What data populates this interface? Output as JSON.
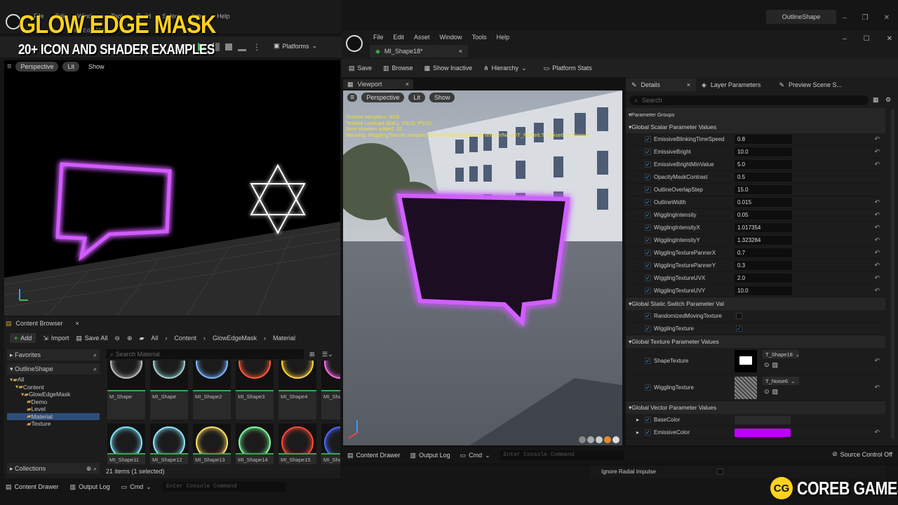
{
  "overlay": {
    "title": "GLOW EDGE MASK",
    "subtitle": "20+ ICON AND SHADER EXAMPLES",
    "brand_mark": "CG",
    "brand_name": "COREB GAMES"
  },
  "left_editor": {
    "menu": [
      "File",
      "Edit",
      "Window",
      "Tools",
      "Build",
      "Select",
      "Actor",
      "Help"
    ],
    "project_tab": "GlowEdgeMask",
    "toolbar": {
      "platforms": "Platforms"
    },
    "viewport": {
      "perspective": "Perspective",
      "lit": "Lit",
      "show": "Show"
    },
    "window_title": "OutlineShape"
  },
  "content_browser": {
    "tab": "Content Browser",
    "add": "Add",
    "import": "Import",
    "save_all": "Save All",
    "breadcrumb": [
      "All",
      "Content",
      "GlowEdgeMask",
      "Material"
    ],
    "favorites": "Favorites",
    "project": "OutlineShape",
    "tree": [
      {
        "label": "All",
        "depth": 0
      },
      {
        "label": "Content",
        "depth": 1
      },
      {
        "label": "GlowEdgeMask",
        "depth": 2
      },
      {
        "label": "Demo",
        "depth": 3
      },
      {
        "label": "Level",
        "depth": 3
      },
      {
        "label": "Material",
        "depth": 3,
        "selected": true
      },
      {
        "label": "Texture",
        "depth": 3
      }
    ],
    "collections": "Collections",
    "search_placeholder": "Search Material",
    "assets_row1": [
      "M_Shape",
      "MI_Shape",
      "MI_Shape2",
      "MI_Shape3",
      "MI_Shape4",
      "MI_Sha"
    ],
    "assets_row2": [
      "MI_Shape11",
      "MI_Shape12",
      "MI_Shape13",
      "MI_Shape14",
      "MI_Shape15",
      "MI_Sha"
    ],
    "status": "21 items (1 selected)"
  },
  "bottom_bar": {
    "content_drawer": "Content Drawer",
    "output_log": "Output Log",
    "cmd": "Cmd",
    "console_placeholder": "Enter Console Command",
    "ignore_radial": "Ignore Radial Impulse"
  },
  "material_editor": {
    "menu": [
      "File",
      "Edit",
      "Asset",
      "Window",
      "Tools",
      "Help"
    ],
    "asset_tab": "MI_Shape18*",
    "toolbar": [
      "Save",
      "Browse",
      "Show Inactive",
      "Hierarchy",
      "Platform Stats"
    ],
    "viewport_tab": "Viewport",
    "viewport_buttons": {
      "perspective": "Perspective",
      "lit": "Lit",
      "show": "Show"
    },
    "stats": [
      "Texture samplers: 4/16",
      "Texture Lookups (Est.): VS(3), PS(2)",
      "Num shaders added: 32",
      "Warning: WigglingTexture samples /Game/GlowEdgeMask/Texture/Noise/T_Noise6.T_Noise6 as Normal"
    ],
    "tabs": [
      "Details",
      "Layer Parameters",
      "Preview Scene S..."
    ],
    "search_placeholder": "Search",
    "parameter_groups": "Parameter Groups",
    "scalar_section": "Global Scalar Parameter Values",
    "scalars": [
      {
        "name": "EmissiveBlinkingTimeSpeed",
        "value": "0.8",
        "reset": true
      },
      {
        "name": "EmissiveBright",
        "value": "10.0",
        "reset": true
      },
      {
        "name": "EmissiveBrightMinValue",
        "value": "5.0",
        "reset": true
      },
      {
        "name": "OpacityMaskContrast",
        "value": "0.5",
        "reset": false
      },
      {
        "name": "OutlineOverlapStep",
        "value": "15.0",
        "reset": false
      },
      {
        "name": "OutlineWidth",
        "value": "0.015",
        "reset": true
      },
      {
        "name": "WigglingIntensity",
        "value": "0.05",
        "reset": true
      },
      {
        "name": "WigglingIntensityX",
        "value": "1.017354",
        "reset": true
      },
      {
        "name": "WigglingIntensityY",
        "value": "1.323284",
        "reset": true
      },
      {
        "name": "WigglingTexturePannerX",
        "value": "0.7",
        "reset": true
      },
      {
        "name": "WigglingTexturePannerY",
        "value": "0.3",
        "reset": true
      },
      {
        "name": "WigglingTextureUVX",
        "value": "2.0",
        "reset": true
      },
      {
        "name": "WigglingTextureUVY",
        "value": "10.0",
        "reset": true
      }
    ],
    "switch_section": "Global Static Switch Parameter Val",
    "switches": [
      {
        "name": "RandomizedMovingTexture",
        "checked": false
      },
      {
        "name": "WigglingTexture",
        "checked": true
      }
    ],
    "texture_section": "Global Texture Parameter Values",
    "textures": [
      {
        "name": "ShapeTexture",
        "asset": "T_Shape18"
      },
      {
        "name": "WigglingTexture",
        "asset": "T_Noise6"
      }
    ],
    "vector_section": "Global Vector Parameter Values",
    "vectors": [
      {
        "name": "BaseColor",
        "color": "#2a2a2a"
      },
      {
        "name": "EmissiveColor",
        "color": "#c000ff"
      }
    ],
    "bottom": {
      "content_drawer": "Content Drawer",
      "output_log": "Output Log",
      "cmd": "Cmd",
      "console_placeholder": "Enter Console Command",
      "source_control": "Source Control Off"
    }
  },
  "colors": {
    "glow": "#cc33ff",
    "accent": "#2f9dff",
    "green": "#3fa34d",
    "title_yellow": "#ffd21f"
  }
}
